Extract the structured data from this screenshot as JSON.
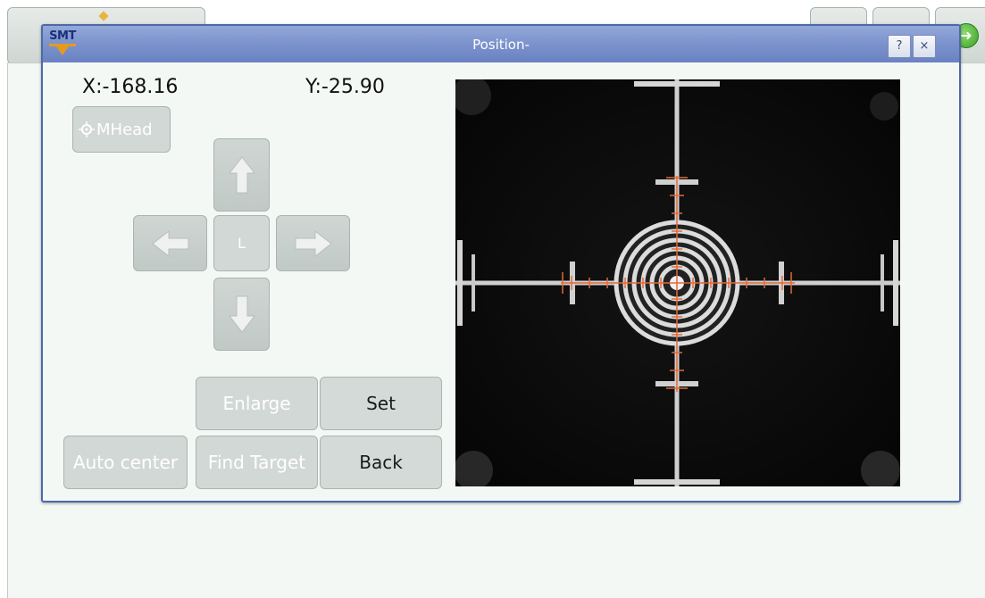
{
  "window": {
    "title": "Position-",
    "help_label": "?",
    "close_label": "×"
  },
  "coords": {
    "x_text": "X:-168.16",
    "y_text": "Y:-25.90"
  },
  "buttons": {
    "mhead": "MHead",
    "center": "L",
    "enlarge": "Enlarge",
    "set": "Set",
    "auto_center": "Auto center",
    "find_target": "Find Target",
    "back": "Back"
  },
  "colors": {
    "titlebar": "#7b92cd",
    "overlay": "#e06a3a",
    "button": "#d2d8d6"
  }
}
